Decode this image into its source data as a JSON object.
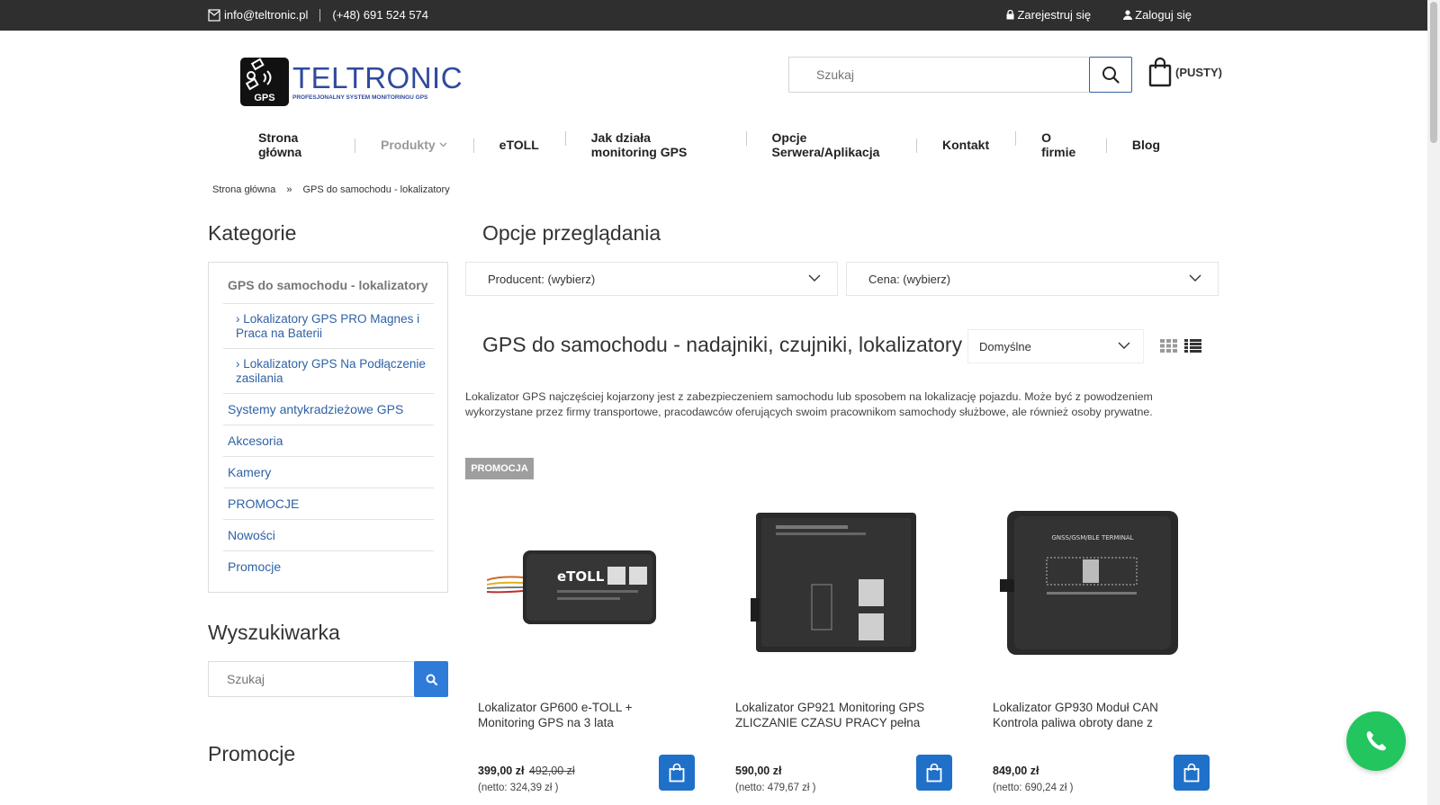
{
  "topbar": {
    "email": "info@teltronic.pl",
    "phone": "(+48) 691 524 574",
    "register": "Zarejestruj się",
    "login": "Zaloguj się"
  },
  "logo": {
    "mark_text": "GPS",
    "name": "TELTRONIC",
    "tagline": "PROFESJONALNY SYSTEM MONITORINGU GPS"
  },
  "search": {
    "placeholder": "Szukaj"
  },
  "cart": {
    "label": "(PUSTY)"
  },
  "nav": {
    "items": [
      "Strona główna",
      "Produkty",
      "eTOLL",
      "Jak działa monitoring GPS",
      "Opcje Serwera/Aplikacja",
      "Kontakt",
      "O firmie",
      "Blog"
    ]
  },
  "breadcrumb": {
    "home": "Strona główna",
    "separator": "»",
    "current": "GPS do samochodu - lokalizatory"
  },
  "sidebar": {
    "categories_title": "Kategorie",
    "categories": [
      "GPS do samochodu - lokalizatory",
      "› Lokalizatory GPS PRO Magnes i Praca na Baterii",
      "› Lokalizatory GPS Na Podłączenie zasilania",
      "Systemy antykradzieżowe GPS",
      "Akcesoria",
      "Kamery",
      "PROMOCJE",
      "Nowości",
      "Promocje"
    ],
    "search_title": "Wyszukiwarka",
    "search_placeholder": "Szukaj",
    "promo_title": "Promocje"
  },
  "filters": {
    "title": "Opcje przeglądania",
    "producer": "Producent: (wybierz)",
    "price": "Cena: (wybierz)"
  },
  "listing": {
    "heading": "GPS do samochodu - nadajniki, czujniki, lokalizatory",
    "sort": "Domyślne",
    "description": "Lokalizator GPS najczęściej kojarzony jest z zabezpieczeniem samochodu lub sposobem na lokalizację pojazdu. Może być z powodzeniem wykorzystane przez firmy transportowe, pracodawców oferujących swoim pracownikom samochody służbowe, ale również osoby prywatne.",
    "promo_badge": "PROMOCJA"
  },
  "products": [
    {
      "title": "Lokalizator GP600 e-TOLL + Monitoring GPS na 3 lata",
      "price": "399,00 zł",
      "old_price": "492,00 zł",
      "net": "(netto: 324,39 zł )",
      "image_label": "eTOLL"
    },
    {
      "title": "Lokalizator GP921 Monitoring GPS ZLICZANIE CZASU PRACY pełna",
      "price": "590,00 zł",
      "old_price": "",
      "net": "(netto: 479,67 zł )",
      "image_label": ""
    },
    {
      "title": "Lokalizator GP930 Moduł CAN Kontrola paliwa obroty dane z",
      "price": "849,00 zł",
      "old_price": "",
      "net": "(netto: 690,24 zł )",
      "image_label": "GNSS/GSM/BLE TERMINAL"
    }
  ],
  "colors": {
    "accent": "#1f70c9",
    "topbar": "#2f2f2f",
    "fab": "#22c55e"
  }
}
